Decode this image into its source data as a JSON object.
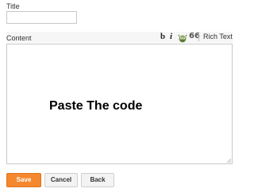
{
  "form": {
    "title_label": "Title",
    "title_value": "",
    "content_label": "Content",
    "content_text": "Paste The code"
  },
  "toolbar": {
    "bold_label": "b",
    "italic_label": "i",
    "monster_icon": "monster-icon",
    "quote_label": "66",
    "rich_text_label": "Rich Text"
  },
  "buttons": {
    "save_label": "Save",
    "cancel_label": "Cancel",
    "back_label": "Back"
  },
  "colors": {
    "save_button": "#f5882f",
    "toolbar_background": "#f6f6f6"
  }
}
